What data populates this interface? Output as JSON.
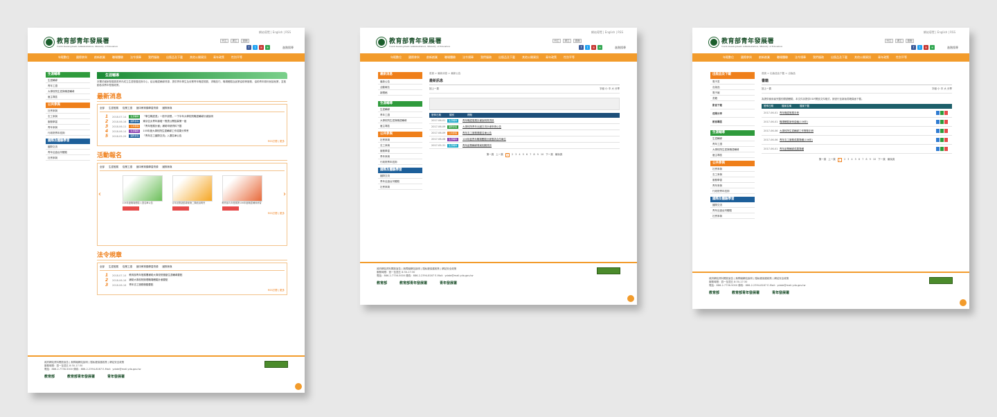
{
  "header": {
    "util": "網站導覽 | English | RSS",
    "logo_title": "教育部青年發展署",
    "logo_sub": "Youth Development Administration, Ministry of Education",
    "tools": [
      "行工",
      "求工",
      "查詢"
    ],
    "social": [
      "f",
      "t",
      "in",
      "+"
    ],
    "sitemap": "進階搜尋"
  },
  "nav": [
    "年輕數位",
    "國際參與",
    "創新創業",
    "職場體驗",
    "法令規章",
    "我們服務",
    "出版品及下載",
    "其他公開資訊",
    "青年政策",
    "性別平等"
  ],
  "screen1": {
    "side": [
      {
        "head": "生涯輔導",
        "color": "g",
        "items": [
          "生涯輔導",
          "青年工讀",
          "大專校院生涯與職涯輔導",
          "雇主專區"
        ]
      },
      {
        "head": "公共參與",
        "color": "o",
        "items": [
          "社會參與",
          "志工參與",
          "服務學習",
          "青年參與",
          "行政院青年諮詢"
        ]
      },
      {
        "head": "國際及體驗學習",
        "color": "b",
        "items": [
          "國際交流",
          "青年壯遊台灣體驗",
          "社會參與"
        ]
      }
    ],
    "banner": "生涯輔導",
    "para": "本署於國家發展委員會內成立生涯發展諮詢中心，結合職涯輔導資源，提供青年學生及待業青年職涯規劃、求職技巧、職場體驗及創業協助等服務，協助青年順利銜接就業，並推動各項青年發展政策。",
    "news_title": "最新消息",
    "tabs": [
      "全部",
      "生涯發展",
      "從業工讀",
      "國中教育類學習資源",
      "國際參與"
    ],
    "news": [
      {
        "num": "1",
        "date": "2018-07-14",
        "tag": "生涯輔導",
        "color": "#2f9b3c",
        "text": "「學生職涯週」一般不設限，一下半年大學校院職涯輔導計畫說明"
      },
      {
        "num": "2",
        "date": "2018-06-16",
        "tag": "國際參與",
        "color": "#1d5f9a",
        "text": "東京亞太青年論壇一覽表公開招募第一屆"
      },
      {
        "num": "3",
        "date": "2018-06-11",
        "tag": "公共參與",
        "color": "#ef7f1a",
        "text": "「青年發展計畫」補助申請資料下載"
      },
      {
        "num": "4",
        "date": "2018-06-14",
        "tag": "生涯輔導",
        "color": "#8a3fb0",
        "text": "105年度大專校院生涯輔導工作成果分享會"
      },
      {
        "num": "5",
        "date": "2018-05-29",
        "tag": "國際參與",
        "color": "#1d5f9a",
        "text": "「青年志工國際交流」入選名單公告"
      }
    ],
    "more": "RSS訂閱 | 更多",
    "events_title": "活動報名",
    "event_tabs": [
      "全部",
      "生涯發展",
      "從業工讀",
      "國中教育類學習資源",
      "國際參與"
    ],
    "events": [
      {
        "img_color": "#6cbf5a",
        "text": "106年度職場體驗入選名單公告"
      },
      {
        "img_color": "#f5a623",
        "text": "青年創業啟動專案第二階段說明會"
      },
      {
        "img_color": "#e86a3a",
        "text": "教育部青年發展署106年度職涯輔導研習"
      }
    ],
    "law_title": "法令規章",
    "laws": [
      {
        "num": "1",
        "date": "2018-07-14",
        "text": "教育部青年發展署補助大專校院推動生涯輔導要點"
      },
      {
        "num": "2",
        "date": "2018-06-16",
        "text": "補助大專校院辦理職場體驗計畫要點"
      },
      {
        "num": "3",
        "date": "2018-06-16",
        "text": "青年志工服務獎勵要點"
      }
    ]
  },
  "screen2": {
    "side_head": "最新消息",
    "side_items": [
      "最新公告",
      "活動報名",
      "新聞稿"
    ],
    "side2": [
      {
        "head": "生涯輔導",
        "color": "g",
        "items": [
          "生涯輔導",
          "青年工讀",
          "大專校院生涯與職涯輔導",
          "雇主專區"
        ]
      },
      {
        "head": "公共參與",
        "color": "o",
        "items": [
          "社會參與",
          "志工參與",
          "服務學習",
          "青年參與",
          "行政院青年諮詢"
        ]
      },
      {
        "head": "國際及體驗學習",
        "color": "b",
        "items": [
          "國際交流",
          "青年壯遊台灣體驗",
          "社會參與"
        ]
      }
    ],
    "crumb": "首頁 > 最新消息 > 最新公告",
    "title": "最新訊息",
    "toolbar_left": "回上一頁",
    "toolbar_right": "字級 小 中 大   分享",
    "cols": [
      "發佈日期",
      "類別",
      "標題"
    ],
    "rows": [
      {
        "date": "2017-06-01",
        "tag": "生涯輔導",
        "color": "#1aa7c7",
        "text": "青年職涯發展計畫說明會資訊"
      },
      {
        "date": "2017-06-09",
        "tag": "國際參與",
        "color": "#2f9b3c",
        "text": "大專校院青年出國交流計畫申請公告"
      },
      {
        "date": "2017-06-09",
        "tag": "公共參與",
        "color": "#ef7f1a",
        "text": "青年志工服務獎勵名單公告"
      },
      {
        "date": "2017-06-06",
        "tag": "生涯輔導",
        "color": "#8a3fb0",
        "text": "106年度青年職場體驗計畫徵求合作單位"
      },
      {
        "date": "2017-05-31",
        "tag": "生涯輔導",
        "color": "#1aa7c7",
        "text": "青年創業輔導專案相關資訊"
      }
    ],
    "pager": [
      "第一頁",
      "上一頁",
      "1",
      "2",
      "3",
      "4",
      "5",
      "6",
      "7",
      "8",
      "9",
      "10",
      "下一頁",
      "最後頁"
    ]
  },
  "screen3": {
    "side_head": "出版品及下載",
    "side_items": [
      "電子書",
      "出版品",
      "電子報",
      "書籍"
    ],
    "side_extra": [
      "影音下載",
      "成果分享",
      "教育專區"
    ],
    "side2": [
      {
        "head": "生涯輔導",
        "color": "g",
        "items": [
          "生涯輔導",
          "青年工讀",
          "大專校院生涯與職涯輔導",
          "雇主專區"
        ]
      },
      {
        "head": "公共參與",
        "color": "o",
        "items": [
          "社會參與",
          "志工參與",
          "服務學習",
          "青年參與",
          "行政院青年諮詢"
        ]
      },
      {
        "head": "國際及體驗學習",
        "color": "b",
        "items": [
          "國際交流",
          "青年壯遊台灣體驗",
          "社會參與"
        ]
      }
    ],
    "crumb": "首頁 > 出版品及下載 > 出版品",
    "title": "書籍",
    "note": "為提供使用者完整的閱讀體驗，本文件另提供ODF開放文件格式，請逕行至新版書籍頁面下載。",
    "cols": [
      "發佈日期",
      "檔案名稱",
      "檔案下載"
    ],
    "rows": [
      {
        "date": "2017-06-01",
        "text": "青年職涯發展手冊"
      },
      {
        "date": "2017-06-01",
        "text": "職場體驗案例彙編(106年)"
      },
      {
        "date": "2017-06-06",
        "text": "大專校院生涯輔導工作實務手冊"
      },
      {
        "date": "2017-06-06",
        "text": "青年志工服務成果專輯(106年)"
      },
      {
        "date": "2017-06-01",
        "text": "青年創業輔導成果專輯"
      }
    ],
    "pager": [
      "第一頁",
      "上一頁",
      "1",
      "2",
      "3",
      "4",
      "5",
      "6",
      "7",
      "8",
      "9",
      "10",
      "下一頁",
      "最後頁"
    ]
  },
  "footer": {
    "line1": "政府網站資料開放宣告 | 無障礙網站說明 | 隱私權保護政策 | 網站安全政策",
    "line2": "服務時間：週一至週五 8:30-17:30",
    "line3": "電話：886-2-7736-5000   傳真：886-2-2394-8167   E-Mail：ydate@mail.yda.gov.tw",
    "logos": [
      "教育部",
      "教育部青年發展署",
      "青年發展署"
    ]
  }
}
